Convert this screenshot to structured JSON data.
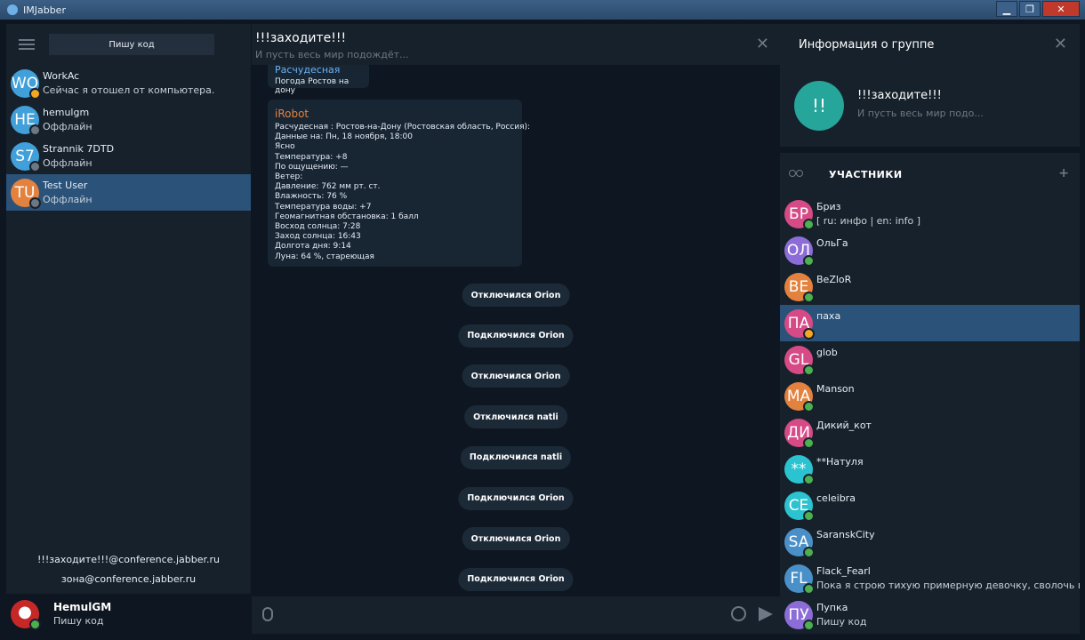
{
  "window": {
    "title": "IMJabber",
    "btn_min": "▁",
    "btn_max": "❐",
    "btn_close": "✕"
  },
  "sidebar": {
    "status_input": "Пишу код",
    "contacts": [
      {
        "initials": "WO",
        "name": "WorkAc",
        "status": "Сейчас я отошел от компьютера.",
        "color": "#419fd9",
        "presence": "away"
      },
      {
        "initials": "HE",
        "name": "hemulgm",
        "status": "Оффлайн",
        "color": "#419fd9",
        "presence": "offline"
      },
      {
        "initials": "S7",
        "name": "Strannik 7DTD",
        "status": "Оффлайн",
        "color": "#419fd9",
        "presence": "offline"
      },
      {
        "initials": "TU",
        "name": "Test User",
        "status": "Оффлайн",
        "color": "#e3823f",
        "presence": "offline"
      }
    ],
    "rooms": [
      "!!!заходите!!!@conference.jabber.ru",
      "зона@conference.jabber.ru"
    ],
    "me": {
      "name": "HemulGM",
      "status": "Пишу код"
    }
  },
  "chat": {
    "title": "!!!заходите!!!",
    "subtitle": "И пусть весь мир подождёт...",
    "close": "✕",
    "messages": [
      {
        "sender": "Расчудесная",
        "text": "Погода Ростов на дону"
      },
      {
        "sender": "iRobot",
        "lines": [
          "Расчудесная : Ростов-на-Дону (Ростовская область, Россия):",
          "Данные на: Пн, 18 ноября, 18:00",
          "Ясно",
          "Температура: +8",
          "По ощущению: —",
          "Ветер:",
          "Давление: 762 мм рт. ст.",
          "Влажность: 76 %",
          "Температура воды: +7",
          "Геомагнитная обстановка: 1 балл",
          "Восход солнца: 7:28",
          "Заход солнца: 16:43",
          "Долгота дня: 9:14",
          "Луна: 64 %, стареющая"
        ]
      }
    ],
    "system": [
      "Отключился Orion",
      "Подключился Orion",
      "Отключился Orion",
      "Отключился natli",
      "Подключился natli",
      "Подключился Orion",
      "Отключился Orion",
      "Подключился Orion"
    ]
  },
  "info": {
    "title": "Информация о группе",
    "close": "✕",
    "group_initials": "!!",
    "group_name": "!!!заходите!!!",
    "group_subtitle": "И пусть весь мир подо...",
    "members_label": "УЧАСТНИКИ",
    "add_member": "+",
    "members": [
      {
        "initials": "БР",
        "name": "Бриз",
        "status": "[ ru: инфо | en: info ]",
        "color": "#d64a86",
        "presence": "online"
      },
      {
        "initials": "ОЛ",
        "name": "ОльГа",
        "status": "",
        "color": "#8c6cd6",
        "presence": "online"
      },
      {
        "initials": "BE",
        "name": "BeZloR",
        "status": "",
        "color": "#e3823f",
        "presence": "online"
      },
      {
        "initials": "ПА",
        "name": "паха",
        "status": "",
        "color": "#d64a86",
        "presence": "away"
      },
      {
        "initials": "GL",
        "name": "glob",
        "status": "",
        "color": "#d64a86",
        "presence": "online"
      },
      {
        "initials": "MA",
        "name": "Manson",
        "status": "",
        "color": "#e3823f",
        "presence": "online"
      },
      {
        "initials": "ДИ",
        "name": "Дикий_кот",
        "status": "",
        "color": "#d64a86",
        "presence": "online"
      },
      {
        "initials": "**",
        "name": "**Натуля",
        "status": "",
        "color": "#2bc3cf",
        "presence": "online"
      },
      {
        "initials": "CE",
        "name": "celeibra",
        "status": "",
        "color": "#2bc3cf",
        "presence": "online"
      },
      {
        "initials": "SA",
        "name": "SaranskCity",
        "status": "",
        "color": "#4a90c8",
        "presence": "online"
      },
      {
        "initials": "FL",
        "name": "Flack_Fearl",
        "status": "Пока я строю тихую примерную девочку, сволочь внутр",
        "color": "#4a90c8",
        "presence": "online"
      },
      {
        "initials": "ПУ",
        "name": "Пупка",
        "status": "Пишу код",
        "color": "#8c6cd6",
        "presence": "online"
      }
    ]
  }
}
